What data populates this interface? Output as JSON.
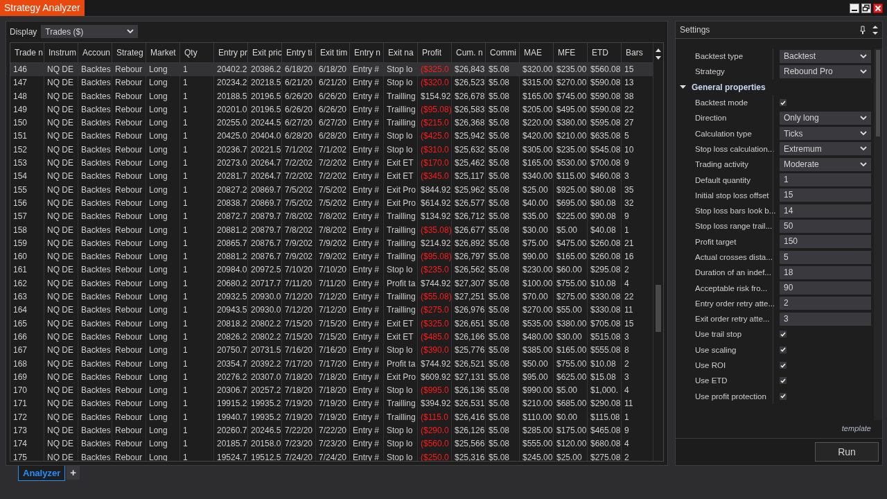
{
  "window": {
    "title": "Strategy Analyzer"
  },
  "display": {
    "label": "Display",
    "value": "Trades ($)"
  },
  "table": {
    "columns": [
      "Trade n",
      "Instrum",
      "Accoun",
      "Strateg",
      "Market",
      "Qty",
      "Entry pr",
      "Exit pric",
      "Entry ti",
      "Exit tim",
      "Entry n",
      "Exit na",
      "Profit",
      "Cum. n",
      "Commi",
      "MAE",
      "MFE",
      "ETD",
      "Bars"
    ],
    "rows": [
      {
        "selected": true,
        "loss": true,
        "cells": [
          "146",
          "NQ DE",
          "Backtes",
          "Rebour",
          "Long",
          "1",
          "20402.2",
          "20386.2",
          "6/18/20",
          "6/18/20",
          "Entry #",
          "Stop lo",
          "($325.0",
          "$26,843",
          "$5.08",
          "$320.00",
          "$235.00",
          "$560.08",
          "15"
        ]
      },
      {
        "selected": false,
        "loss": true,
        "cells": [
          "147",
          "NQ DE",
          "Backtes",
          "Rebour",
          "Long",
          "1",
          "20234.2",
          "20218.5",
          "6/21/20",
          "6/21/20",
          "Entry #",
          "Stop lo",
          "($320.0",
          "$26,523",
          "$5.08",
          "$315.00",
          "$270.00",
          "$590.08",
          "13"
        ]
      },
      {
        "selected": false,
        "loss": false,
        "cells": [
          "148",
          "NQ DE",
          "Backtes",
          "Rebour",
          "Long",
          "1",
          "20188.5",
          "20196.5",
          "6/26/20",
          "6/26/20",
          "Entry #",
          "Trailling",
          "$154.92",
          "$26,678",
          "$5.08",
          "$165.00",
          "$745.00",
          "$590.08",
          "38"
        ]
      },
      {
        "selected": false,
        "loss": true,
        "cells": [
          "149",
          "NQ DE",
          "Backtes",
          "Rebour",
          "Long",
          "1",
          "20201.0",
          "20196.5",
          "6/26/20",
          "6/26/20",
          "Entry #",
          "Trailling",
          "($95.08)",
          "$26,583",
          "$5.08",
          "$205.00",
          "$495.00",
          "$590.08",
          "22"
        ]
      },
      {
        "selected": false,
        "loss": true,
        "cells": [
          "150",
          "NQ DE",
          "Backtes",
          "Rebour",
          "Long",
          "1",
          "20255.0",
          "20244.5",
          "6/27/20",
          "6/27/20",
          "Entry #",
          "Trailling",
          "($215.0",
          "$26,368",
          "$5.08",
          "$220.00",
          "$380.00",
          "$595.08",
          "27"
        ]
      },
      {
        "selected": false,
        "loss": true,
        "cells": [
          "151",
          "NQ DE",
          "Backtes",
          "Rebour",
          "Long",
          "1",
          "20425.0",
          "20404.0",
          "6/28/20",
          "6/28/20",
          "Entry #",
          "Stop lo",
          "($425.0",
          "$25,942",
          "$5.08",
          "$420.00",
          "$210.00",
          "$635.08",
          "5"
        ]
      },
      {
        "selected": false,
        "loss": true,
        "cells": [
          "152",
          "NQ DE",
          "Backtes",
          "Rebour",
          "Long",
          "1",
          "20236.7",
          "20221.5",
          "7/1/202",
          "7/1/202",
          "Entry #",
          "Stop lo",
          "($310.0",
          "$25,632",
          "$5.08",
          "$305.00",
          "$235.00",
          "$545.08",
          "10"
        ]
      },
      {
        "selected": false,
        "loss": true,
        "cells": [
          "153",
          "NQ DE",
          "Backtes",
          "Rebour",
          "Long",
          "1",
          "20273.0",
          "20264.7",
          "7/2/202",
          "7/2/202",
          "Entry #",
          "Exit ET",
          "($170.0",
          "$25,462",
          "$5.08",
          "$165.00",
          "$530.00",
          "$700.08",
          "9"
        ]
      },
      {
        "selected": false,
        "loss": true,
        "cells": [
          "154",
          "NQ DE",
          "Backtes",
          "Rebour",
          "Long",
          "1",
          "20281.7",
          "20264.7",
          "7/2/202",
          "7/2/202",
          "Entry #",
          "Exit ET",
          "($345.0",
          "$25,117",
          "$5.08",
          "$340.00",
          "$115.00",
          "$460.08",
          "3"
        ]
      },
      {
        "selected": false,
        "loss": false,
        "cells": [
          "155",
          "NQ DE",
          "Backtes",
          "Rebour",
          "Long",
          "1",
          "20827.2",
          "20869.7",
          "7/5/202",
          "7/5/202",
          "Entry #",
          "Exit Pro",
          "$844.92",
          "$25,962",
          "$5.08",
          "$25.00",
          "$925.00",
          "$80.08",
          "35"
        ]
      },
      {
        "selected": false,
        "loss": false,
        "cells": [
          "156",
          "NQ DE",
          "Backtes",
          "Rebour",
          "Long",
          "1",
          "20838.7",
          "20869.7",
          "7/5/202",
          "7/5/202",
          "Entry #",
          "Exit Pro",
          "$614.92",
          "$26,577",
          "$5.08",
          "$40.00",
          "$695.00",
          "$80.08",
          "32"
        ]
      },
      {
        "selected": false,
        "loss": false,
        "cells": [
          "157",
          "NQ DE",
          "Backtes",
          "Rebour",
          "Long",
          "1",
          "20872.7",
          "20879.7",
          "7/8/202",
          "7/8/202",
          "Entry #",
          "Trailling",
          "$134.92",
          "$26,712",
          "$5.08",
          "$35.00",
          "$225.00",
          "$90.08",
          "9"
        ]
      },
      {
        "selected": false,
        "loss": true,
        "cells": [
          "158",
          "NQ DE",
          "Backtes",
          "Rebour",
          "Long",
          "1",
          "20881.2",
          "20879.7",
          "7/8/202",
          "7/8/202",
          "Entry #",
          "Trailling",
          "($35.08)",
          "$26,677",
          "$5.08",
          "$30.00",
          "$5.00",
          "$40.08",
          "1"
        ]
      },
      {
        "selected": false,
        "loss": false,
        "cells": [
          "159",
          "NQ DE",
          "Backtes",
          "Rebour",
          "Long",
          "1",
          "20865.7",
          "20876.7",
          "7/9/202",
          "7/9/202",
          "Entry #",
          "Trailling",
          "$214.92",
          "$26,892",
          "$5.08",
          "$75.00",
          "$475.00",
          "$260.08",
          "21"
        ]
      },
      {
        "selected": false,
        "loss": true,
        "cells": [
          "160",
          "NQ DE",
          "Backtes",
          "Rebour",
          "Long",
          "1",
          "20881.2",
          "20876.7",
          "7/9/202",
          "7/9/202",
          "Entry #",
          "Trailling",
          "($95.08)",
          "$26,797",
          "$5.08",
          "$90.00",
          "$165.00",
          "$260.08",
          "16"
        ]
      },
      {
        "selected": false,
        "loss": true,
        "cells": [
          "161",
          "NQ DE",
          "Backtes",
          "Rebour",
          "Long",
          "1",
          "20984.0",
          "20972.5",
          "7/10/20",
          "7/10/20",
          "Entry #",
          "Stop lo",
          "($235.0",
          "$26,562",
          "$5.08",
          "$230.00",
          "$60.00",
          "$295.08",
          "2"
        ]
      },
      {
        "selected": false,
        "loss": false,
        "cells": [
          "162",
          "NQ DE",
          "Backtes",
          "Rebour",
          "Long",
          "1",
          "20680.2",
          "20717.7",
          "7/11/20",
          "7/11/20",
          "Entry #",
          "Profit ta",
          "$744.92",
          "$27,307",
          "$5.08",
          "$100.00",
          "$755.00",
          "$10.08",
          "4"
        ]
      },
      {
        "selected": false,
        "loss": true,
        "cells": [
          "163",
          "NQ DE",
          "Backtes",
          "Rebour",
          "Long",
          "1",
          "20932.5",
          "20930.0",
          "7/12/20",
          "7/12/20",
          "Entry #",
          "Trailling",
          "($55.08)",
          "$27,251",
          "$5.08",
          "$70.00",
          "$275.00",
          "$330.08",
          "22"
        ]
      },
      {
        "selected": false,
        "loss": true,
        "cells": [
          "164",
          "NQ DE",
          "Backtes",
          "Rebour",
          "Long",
          "1",
          "20943.5",
          "20930.0",
          "7/12/20",
          "7/12/20",
          "Entry #",
          "Trailling",
          "($275.0",
          "$26,976",
          "$5.08",
          "$270.00",
          "$55.00",
          "$330.08",
          "11"
        ]
      },
      {
        "selected": false,
        "loss": true,
        "cells": [
          "165",
          "NQ DE",
          "Backtes",
          "Rebour",
          "Long",
          "1",
          "20818.2",
          "20802.2",
          "7/15/20",
          "7/15/20",
          "Entry #",
          "Exit ET",
          "($325.0",
          "$26,651",
          "$5.08",
          "$535.00",
          "$380.00",
          "$705.08",
          "15"
        ]
      },
      {
        "selected": false,
        "loss": true,
        "cells": [
          "166",
          "NQ DE",
          "Backtes",
          "Rebour",
          "Long",
          "1",
          "20826.2",
          "20802.2",
          "7/15/20",
          "7/15/20",
          "Entry #",
          "Exit ET",
          "($485.0",
          "$26,166",
          "$5.08",
          "$480.00",
          "$30.00",
          "$515.08",
          "3"
        ]
      },
      {
        "selected": false,
        "loss": true,
        "cells": [
          "167",
          "NQ DE",
          "Backtes",
          "Rebour",
          "Long",
          "1",
          "20750.7",
          "20731.5",
          "7/16/20",
          "7/16/20",
          "Entry #",
          "Stop lo",
          "($390.0",
          "$25,776",
          "$5.08",
          "$385.00",
          "$165.00",
          "$555.08",
          "8"
        ]
      },
      {
        "selected": false,
        "loss": false,
        "cells": [
          "168",
          "NQ DE",
          "Backtes",
          "Rebour",
          "Long",
          "1",
          "20354.7",
          "20392.2",
          "7/17/20",
          "7/17/20",
          "Entry #",
          "Profit ta",
          "$744.92",
          "$26,521",
          "$5.08",
          "$50.00",
          "$755.00",
          "$10.08",
          "2"
        ]
      },
      {
        "selected": false,
        "loss": false,
        "cells": [
          "169",
          "NQ DE",
          "Backtes",
          "Rebour",
          "Long",
          "1",
          "20276.2",
          "20307.0",
          "7/18/20",
          "7/18/20",
          "Entry #",
          "Exit Pro",
          "$609.92",
          "$27,131",
          "$5.08",
          "$95.00",
          "$625.00",
          "$15.08",
          "3"
        ]
      },
      {
        "selected": false,
        "loss": true,
        "cells": [
          "170",
          "NQ DE",
          "Backtes",
          "Rebour",
          "Long",
          "1",
          "20306.7",
          "20257.2",
          "7/18/20",
          "7/18/20",
          "Entry #",
          "Stop lo",
          "($995.0",
          "$26,136",
          "$5.08",
          "$990.00",
          "$5.00",
          "$1,000.",
          "4"
        ]
      },
      {
        "selected": false,
        "loss": false,
        "cells": [
          "171",
          "NQ DE",
          "Backtes",
          "Rebour",
          "Long",
          "1",
          "19915.2",
          "19935.2",
          "7/19/20",
          "7/19/20",
          "Entry #",
          "Trailling",
          "$394.92",
          "$26,531",
          "$5.08",
          "$210.00",
          "$685.00",
          "$290.08",
          "11"
        ]
      },
      {
        "selected": false,
        "loss": true,
        "cells": [
          "172",
          "NQ DE",
          "Backtes",
          "Rebour",
          "Long",
          "1",
          "19940.7",
          "19935.2",
          "7/19/20",
          "7/19/20",
          "Entry #",
          "Trailling",
          "($115.0",
          "$26,416",
          "$5.08",
          "$110.00",
          "$0.00",
          "$115.08",
          "1"
        ]
      },
      {
        "selected": false,
        "loss": true,
        "cells": [
          "173",
          "NQ DE",
          "Backtes",
          "Rebour",
          "Long",
          "1",
          "20260.7",
          "20246.5",
          "7/22/20",
          "7/22/20",
          "Entry #",
          "Stop lo",
          "($290.0",
          "$26,126",
          "$5.08",
          "$285.00",
          "$175.00",
          "$465.08",
          "9"
        ]
      },
      {
        "selected": false,
        "loss": true,
        "cells": [
          "174",
          "NQ DE",
          "Backtes",
          "Rebour",
          "Long",
          "1",
          "20185.7",
          "20158.0",
          "7/23/20",
          "7/23/20",
          "Entry #",
          "Stop lo",
          "($560.0",
          "$25,566",
          "$5.08",
          "$555.00",
          "$120.00",
          "$680.08",
          "4"
        ]
      },
      {
        "selected": false,
        "loss": true,
        "cells": [
          "175",
          "NQ DE",
          "Backtes",
          "Rebour",
          "Long",
          "1",
          "19524.7",
          "19512.5",
          "7/24/20",
          "7/24/20",
          "Entry #",
          "Stop lo",
          "($250.0",
          "$25,316",
          "$5.08",
          "$245.00",
          "$25.00",
          "$275.08",
          "2"
        ]
      }
    ]
  },
  "settings": {
    "title": "Settings",
    "groups": [
      {
        "properties": [
          {
            "kind": "dropdown",
            "label": "Backtest type",
            "value": "Backtest"
          },
          {
            "kind": "dropdown",
            "label": "Strategy",
            "value": "Rebound Pro"
          }
        ]
      },
      {
        "name": "General properties",
        "expanded": true,
        "properties": [
          {
            "kind": "checkbox",
            "label": "Backtest mode",
            "checked": true
          },
          {
            "kind": "dropdown",
            "label": "Direction",
            "value": "Only long"
          },
          {
            "kind": "dropdown",
            "label": "Calculation type",
            "value": "Ticks"
          },
          {
            "kind": "dropdown",
            "label": "Stop loss calculation...",
            "value": "Extremum"
          },
          {
            "kind": "dropdown",
            "label": "Trading activity",
            "value": "Moderate"
          },
          {
            "kind": "number",
            "label": "Default quantity",
            "value": "1"
          },
          {
            "kind": "number",
            "label": "Initial stop loss offset",
            "value": "15"
          },
          {
            "kind": "number",
            "label": "Stop loss bars look b...",
            "value": "14"
          },
          {
            "kind": "number",
            "label": "Stop loss range trail...",
            "value": "50"
          },
          {
            "kind": "number",
            "label": "Profit target",
            "value": "150"
          },
          {
            "kind": "number",
            "label": "Actual crosses dista...",
            "value": "5"
          },
          {
            "kind": "number",
            "label": "Duration of an indef...",
            "value": "18"
          },
          {
            "kind": "number",
            "label": "Acceptable risk fro...",
            "value": "90"
          },
          {
            "kind": "number",
            "label": "Entry order retry atte...",
            "value": "2"
          },
          {
            "kind": "number",
            "label": "Exit order retry atte...",
            "value": "3"
          },
          {
            "kind": "checkbox",
            "label": "Use trail stop",
            "checked": true
          },
          {
            "kind": "checkbox",
            "label": "Use scaling",
            "checked": true
          },
          {
            "kind": "checkbox",
            "label": "Use ROI",
            "checked": true
          },
          {
            "kind": "checkbox",
            "label": "Use ETD",
            "checked": true
          },
          {
            "kind": "checkbox",
            "label": "Use profit protection",
            "checked": true
          }
        ]
      }
    ],
    "template_link": "template",
    "run_button": "Run"
  },
  "bottom_tabs": [
    {
      "label": "Analyzer",
      "selected": true
    }
  ],
  "add_tab_button": "+"
}
